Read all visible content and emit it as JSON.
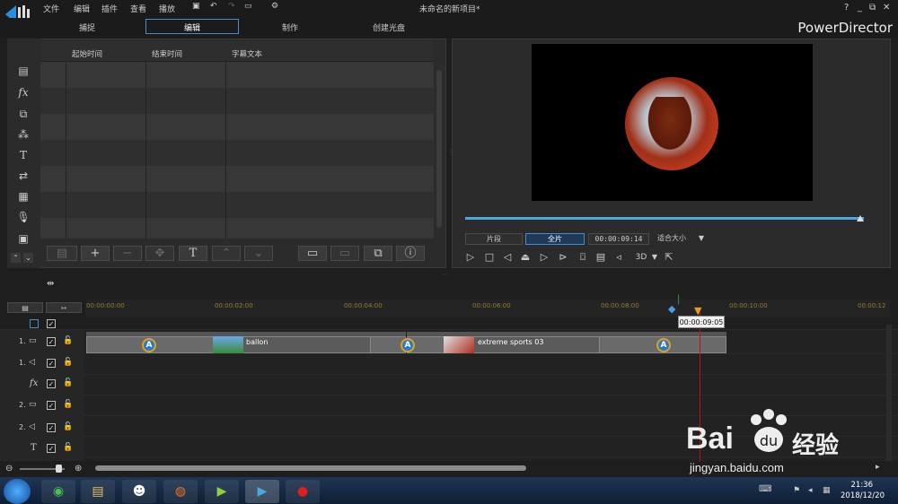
{
  "menubar": {
    "items": [
      "文件",
      "编辑",
      "插件",
      "查看",
      "播放"
    ],
    "title": "未命名的新项目*"
  },
  "tabs": [
    "捕捉",
    "编辑",
    "制作",
    "创建光盘"
  ],
  "brand": "PowerDirector",
  "window_controls": [
    "?",
    "_",
    "⧉",
    "✕"
  ],
  "table": {
    "headers": [
      "起始时间",
      "结束时间",
      "字幕文本"
    ]
  },
  "preview": {
    "segment_label": "片段",
    "full_label": "全片",
    "timecode": "00:00:09:14",
    "fit_label": "适合大小",
    "fit_arrow": "▼",
    "mode3d": "3D"
  },
  "timeline": {
    "ruler_ticks": [
      "00:00:00:00",
      "00:00:02:00",
      "00:00:04:00",
      "00:00:06:00",
      "00:00:08:00",
      "00:00:10:00",
      "00:00:12"
    ],
    "tooltip": "00:00:09:05",
    "tracks": [
      {
        "label": "1.",
        "type": "video-icon"
      },
      {
        "label": "1.",
        "type": "audio-icon"
      },
      {
        "label": "fx",
        "type": "fx-icon"
      },
      {
        "label": "2.",
        "type": "video-icon"
      },
      {
        "label": "2.",
        "type": "audio-icon"
      },
      {
        "label": "T",
        "type": "title-icon"
      }
    ],
    "clips": [
      {
        "name": "ballon"
      },
      {
        "name": "extreme sports 03"
      }
    ]
  },
  "taskbar": {
    "time": "21:36",
    "date": "2018/12/20"
  },
  "watermark": {
    "brand": "Bai",
    "brand2": "经验",
    "url": "jingyan.baidu.com"
  }
}
